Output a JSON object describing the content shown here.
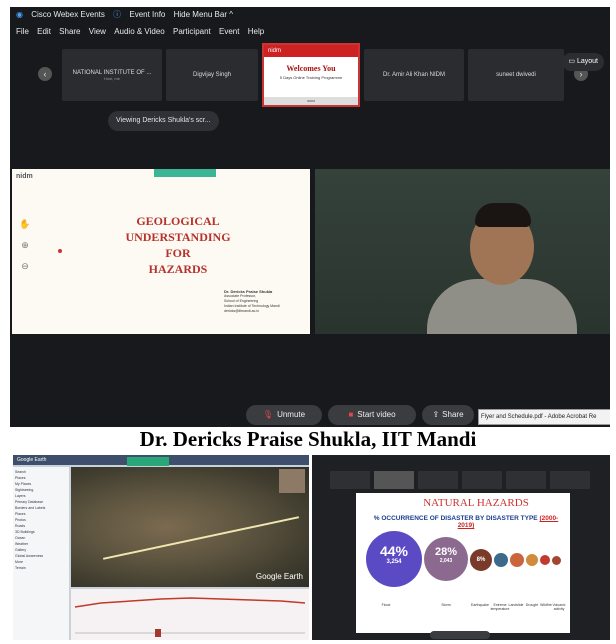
{
  "top_window": {
    "title_items": [
      "Cisco Webex Events",
      "Event Info",
      "Hide Menu Bar ^"
    ],
    "menu_items": [
      "File",
      "Edit",
      "Share",
      "View",
      "Audio & Video",
      "Participant",
      "Event",
      "Help"
    ],
    "thumbnails": [
      {
        "name": "NATIONAL INSTITUTE OF ...",
        "sub": "Host, me"
      },
      {
        "name": "Digvijay Singh",
        "sub": ""
      },
      {
        "name": "Dr. Amir Ali Khan NIDM",
        "sub": ""
      },
      {
        "name": "suneet dwivedi",
        "sub": ""
      }
    ],
    "welcome": {
      "header": "nidm",
      "title": "Welcomes You",
      "subtitle": "5 Days Online Training Programme",
      "footer": "NIDM"
    },
    "layout_label": "Layout",
    "viewing_label": "Viewing Dericks Shukla's scr...",
    "slide": {
      "logo": "nidm",
      "title_lines": [
        "GEOLOGICAL",
        "UNDERSTANDING",
        "FOR",
        "HAZARDS"
      ],
      "author_name": "Dr. Dericks Praise Shukla",
      "author_lines": [
        "Associate Professor,",
        "School of Engineering",
        "Indian Institute of Technology Mandi",
        "dericks@iitmandi.ac.in"
      ]
    },
    "controls": {
      "unmute": "Unmute",
      "start_video": "Start video",
      "share": "Share",
      "tooltip": "Flyer and Schedule.pdf - Adobe Acrobat Re"
    }
  },
  "caption": "Dr. Dericks Praise Shukla, IIT Mandi",
  "bottom_left": {
    "app_title": "Google Earth",
    "map_label": "Google Earth",
    "sidebar_lines": [
      "Search",
      "Places",
      "My Places",
      "Sightseeing",
      "Layers",
      "Primary Database",
      "Borders and Labels",
      "Places",
      "Photos",
      "Roads",
      "3D Buildings",
      "Ocean",
      "Weather",
      "Gallery",
      "Global Awareness",
      "More",
      "Terrain"
    ]
  },
  "bottom_right": {
    "slide_title": "NATURAL HAZARDS",
    "slide_subtitle": "% OCCURRENCE OF DISASTER BY DISASTER TYPE",
    "slide_years": "(2000-2019)",
    "big_pct": "44%",
    "big_count": "3,254",
    "second_pct": "28%",
    "second_count": "2,043",
    "third_pct": "8%",
    "labels": [
      "Flood",
      "Storm",
      "Earthquake",
      "Extreme temperature",
      "Landslide",
      "Drought",
      "Wildfire",
      "Volcanic activity",
      "Mass movement (dry)"
    ]
  },
  "colors": {
    "webex_bg": "#17191c",
    "slide_title": "#b6322a",
    "accent_red": "#e14747",
    "bubble_big": "#5a4bc4",
    "bubble_second": "#8c6a8f",
    "bubble_third": "#7a3a2a"
  },
  "icons": [
    "webex-logo-icon",
    "info-icon",
    "chevron-left-icon",
    "chevron-right-icon",
    "layout-icon",
    "mic-off-icon",
    "video-off-icon",
    "share-icon",
    "zoom-in-icon",
    "zoom-out-icon",
    "hand-icon"
  ]
}
